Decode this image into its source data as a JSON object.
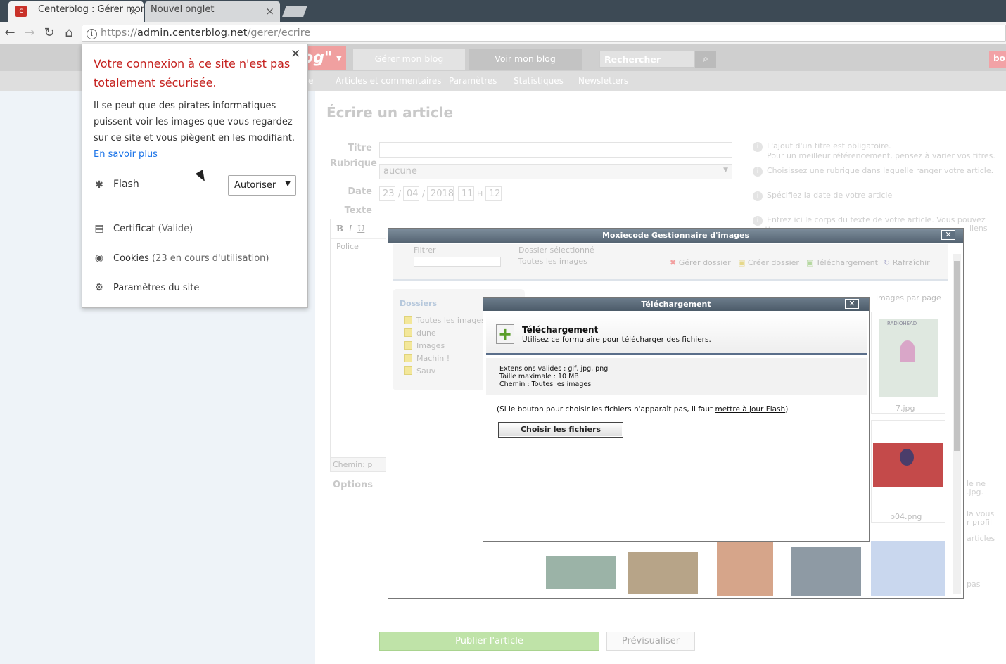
{
  "browser": {
    "tabs": [
      {
        "title": "Centerblog : Gérer mon",
        "favicon": "centerblog-logo",
        "active": true
      },
      {
        "title": "Nouvel onglet",
        "active": false
      }
    ],
    "url_secure_part": "https://",
    "url_host": "admin.centerblog.net",
    "url_path": "/gerer/ecrire"
  },
  "site_header": {
    "logo_text": "og\"",
    "nav": [
      "Gérer mon blog",
      "Voir mon blog"
    ],
    "search_placeholder": "Rechercher",
    "red_chip_text": "bo",
    "subnav": [
      "e",
      "Articles et commentaires",
      "Paramètres",
      "Statistiques",
      "Newsletters"
    ]
  },
  "form": {
    "page_title": "Écrire un article",
    "labels": {
      "titre": "Titre",
      "rubrique": "Rubrique",
      "date": "Date",
      "texte": "Texte",
      "options": "Options"
    },
    "rubrique_value": "aucune",
    "date": {
      "day": "23",
      "month": "04",
      "year": "2018",
      "hour": "11",
      "h_sep": "H",
      "minute": "12",
      "sep": "/"
    },
    "editor_font_label": "Police",
    "editor_path": "Chemin: p",
    "help": [
      "L'ajout d'un titre est obligatoire.",
      "Pour un meilleur référencement, pensez à varier vos titres.",
      "Choisissez une rubrique dans laquelle ranger votre article.",
      "Spécifiez la date de votre article",
      "Entrez ici le corps du texte de votre article. Vous pouvez mettre",
      "liens"
    ],
    "side_fragments": [
      "le ne",
      ".jpg.",
      "la vous",
      "r profil",
      "articles",
      "pas"
    ],
    "publish_button": "Publier l'article",
    "preview_button": "Prévisualiser"
  },
  "moxiecode": {
    "title": "Moxiecode Gestionnaire d'images",
    "filter_label": "Filtrer",
    "selected_folder_label": "Dossier sélectionné",
    "selected_folder_value": "Toutes les images",
    "actions": [
      "Gérer dossier",
      "Créer dossier",
      "Téléchargement",
      "Rafraîchir"
    ],
    "folders_title": "Dossiers",
    "folders": [
      "Toutes les images",
      "dune",
      "Images",
      "Machin !",
      "Sauv"
    ],
    "per_page_label": "images par page",
    "thumb_captions": [
      "7.jpg",
      "p04.png"
    ],
    "radiohead_text": "RADIOHEAD"
  },
  "upload_dialog": {
    "title": "Téléchargement",
    "heading": "Téléchargement",
    "subheading": "Utilisez ce formulaire pour télécharger des fichiers.",
    "extensions": "Extensions valides : gif, jpg, png",
    "max_size": "Taille maximale : 10 MB",
    "path": "Chemin : Toutes les images",
    "flash_note_before": "(Si le bouton pour choisir les fichiers n'apparaît pas, il faut ",
    "flash_link": "mettre à jour Flash",
    "flash_note_after": ")",
    "choose_button": "Choisir les fichiers"
  },
  "security_popup": {
    "title": "Votre connexion à ce site n'est pas totalement sécurisée.",
    "body": "Il se peut que des pirates informatiques puissent voir les images que vous regardez sur ce site et vous piègent en les modifiant.",
    "learn_more": "En savoir plus",
    "flash_label": "Flash",
    "flash_select_value": "Autoriser",
    "certificate_label": "Certificat",
    "certificate_status": "(Valide)",
    "cookies_label": "Cookies",
    "cookies_status": "(23 en cours d'utilisation)",
    "site_settings_label": "Paramètres du site"
  },
  "colors": {
    "chrome_dark": "#3d4a55",
    "warning_red": "#c5221f",
    "link_blue": "#1a73e8",
    "publish_green": "#bfe3a8"
  }
}
